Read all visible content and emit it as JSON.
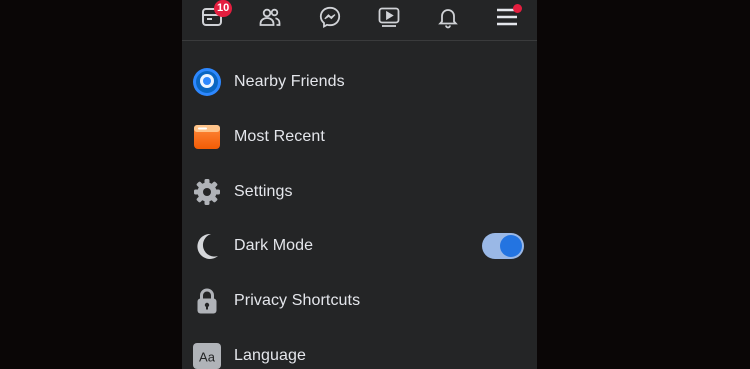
{
  "navbar": {
    "items": [
      {
        "icon": "feed-icon",
        "badge": "10"
      },
      {
        "icon": "friends-icon"
      },
      {
        "icon": "messenger-icon"
      },
      {
        "icon": "watch-icon"
      },
      {
        "icon": "bell-icon"
      },
      {
        "icon": "menu-icon",
        "has_dot": true
      }
    ]
  },
  "menu": {
    "items": [
      {
        "icon": "nearby-friends-icon",
        "label": "Nearby Friends"
      },
      {
        "icon": "most-recent-icon",
        "label": "Most Recent"
      },
      {
        "icon": "settings-gear-icon",
        "label": "Settings"
      },
      {
        "icon": "moon-icon",
        "label": "Dark Mode",
        "toggle_on": true
      },
      {
        "icon": "lock-icon",
        "label": "Privacy Shortcuts"
      },
      {
        "icon": "language-icon",
        "label": "Language",
        "icon_text": "Aa"
      }
    ]
  },
  "colors": {
    "background": "#242526",
    "text": "#e4e6eb",
    "badge": "#e41e3f",
    "toggle_on": "#2374e1"
  }
}
